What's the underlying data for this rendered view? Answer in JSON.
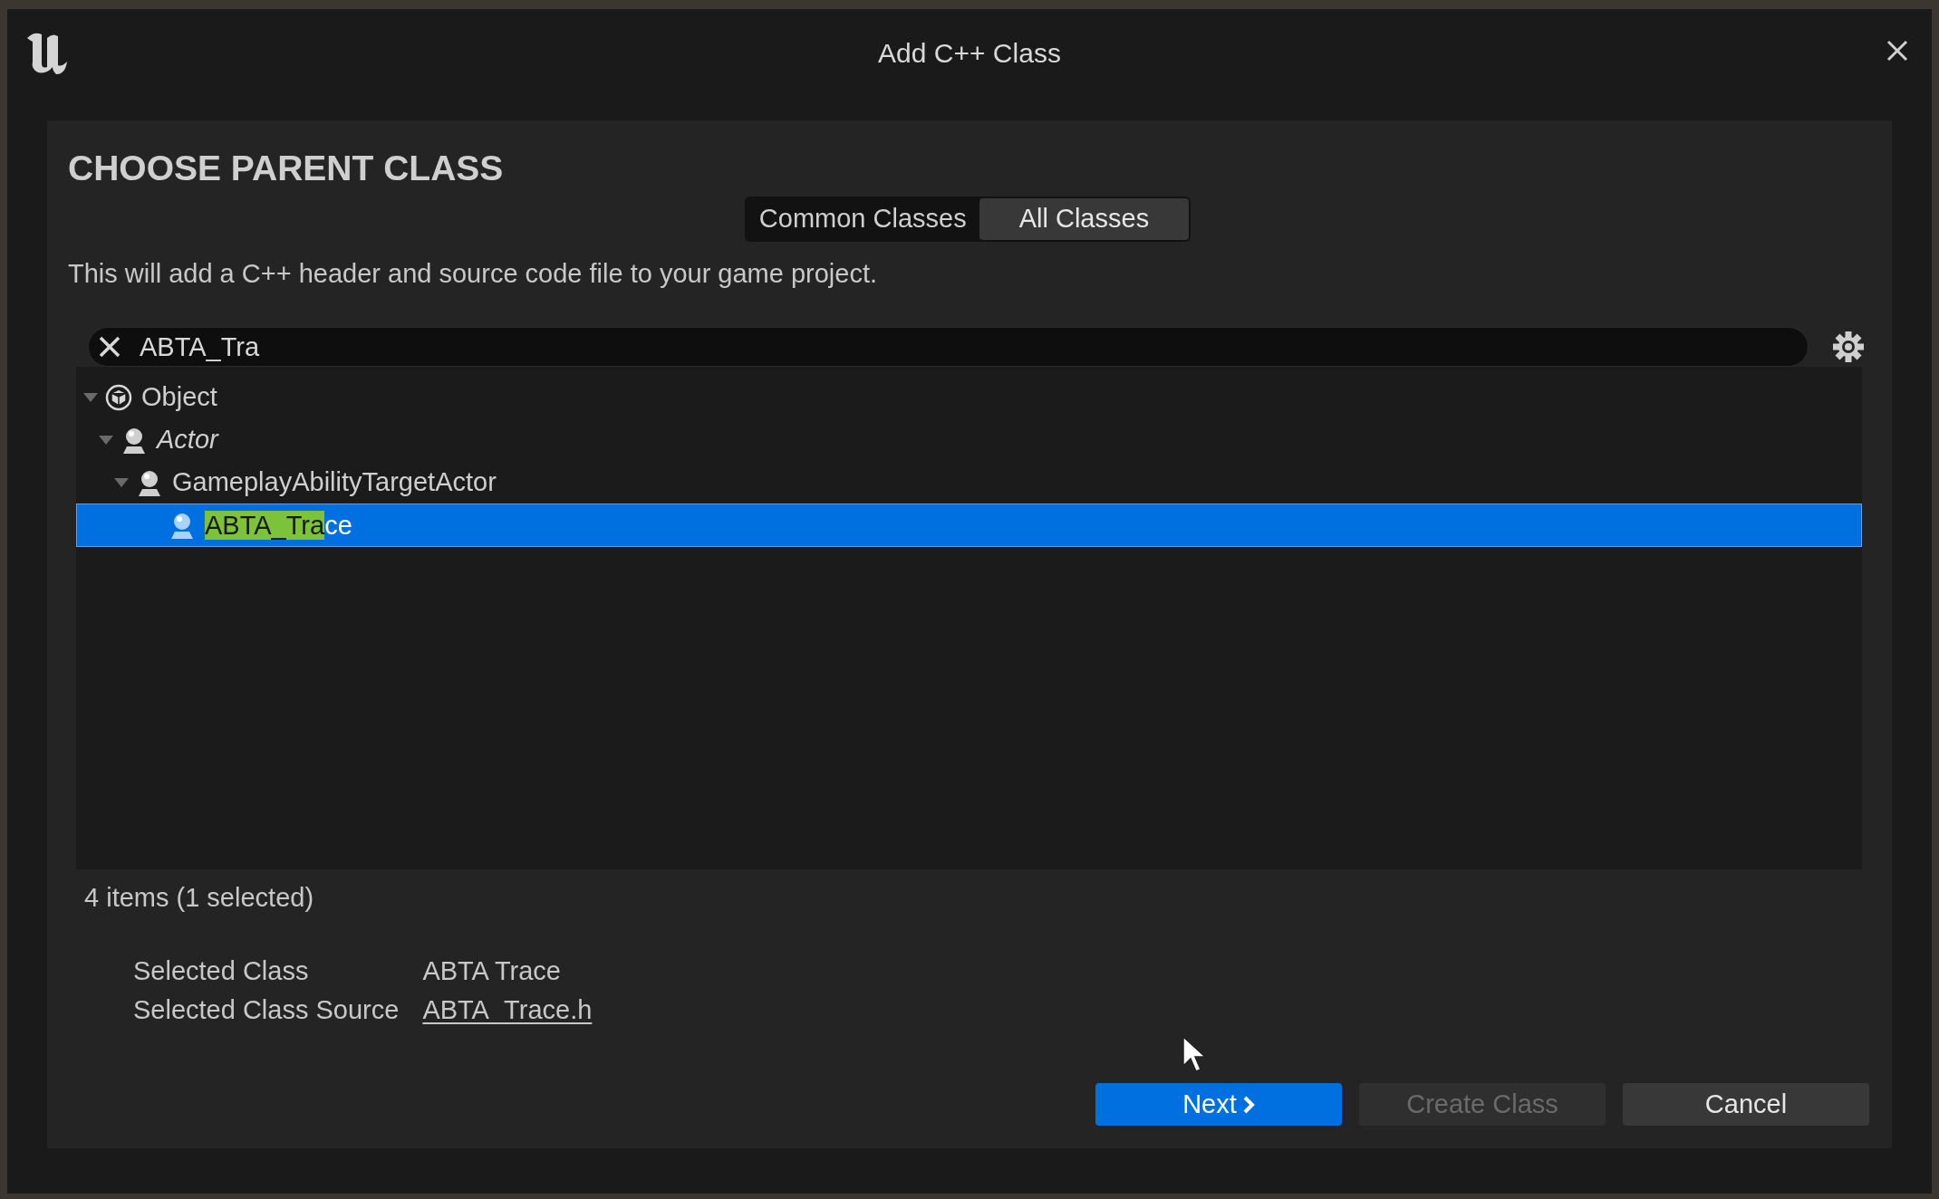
{
  "window": {
    "title": "Add C++ Class"
  },
  "heading": "CHOOSE PARENT CLASS",
  "tabs": [
    {
      "label": "Common Classes",
      "selected": false
    },
    {
      "label": "All Classes",
      "selected": true
    }
  ],
  "description": "This will add a C++ header and source code file to your game project.",
  "search": {
    "value": "ABTA_Tra"
  },
  "tree": [
    {
      "label": "Object",
      "kind": "object",
      "italic": false,
      "expanded": true,
      "selected": false,
      "children": [
        {
          "label": "Actor",
          "kind": "actor",
          "italic": true,
          "expanded": true,
          "selected": false,
          "children": [
            {
              "label": "GameplayAbilityTargetActor",
              "kind": "actor",
              "italic": false,
              "expanded": true,
              "selected": false,
              "children": [
                {
                  "highlight": "ABTA_Tra",
                  "label": "ce",
                  "kind": "actor",
                  "italic": false,
                  "selected": true
                }
              ]
            }
          ]
        }
      ]
    }
  ],
  "status": "4 items (1 selected)",
  "details": [
    {
      "label": "Selected Class",
      "value": "ABTA Trace",
      "kind": "text"
    },
    {
      "label": "Selected Class Source",
      "value": "ABTA_Trace.h",
      "kind": "link"
    }
  ],
  "buttons": [
    {
      "label": "Next",
      "kind": "primary",
      "disabled": false
    },
    {
      "label": "Create Class",
      "kind": "normal",
      "disabled": true
    },
    {
      "label": "Cancel",
      "kind": "normal",
      "disabled": false
    }
  ]
}
